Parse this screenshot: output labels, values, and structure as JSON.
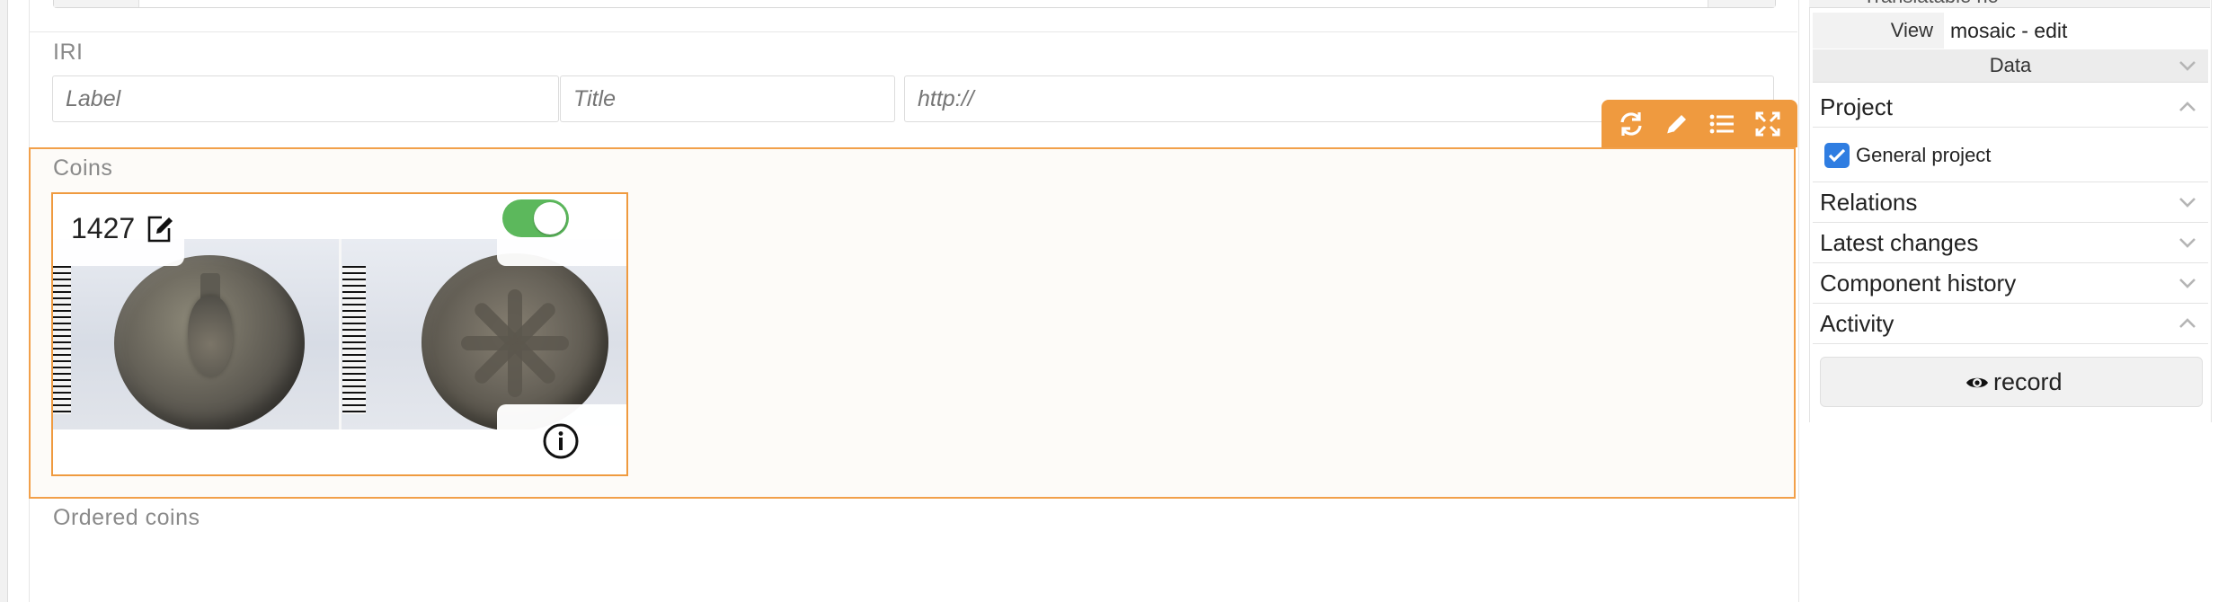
{
  "main": {
    "iri": {
      "label": "IRI",
      "label_placeholder": "Label",
      "title_placeholder": "Title",
      "url_placeholder": "http://"
    },
    "coins": {
      "label": "Coins",
      "card": {
        "record_id": "1427",
        "published": true,
        "image_alt": "Coin obverse and reverse"
      }
    },
    "ordered_coins": {
      "label": "Ordered coins"
    },
    "toolbar": {
      "icons": [
        "refresh-icon",
        "pencil-icon",
        "list-icon",
        "expand-icon"
      ]
    }
  },
  "sidebar": {
    "top_cut_text": "Translatable  no",
    "view_key": "View",
    "view_value": "mosaic - edit",
    "data_bar": "Data",
    "sections": {
      "project": "Project",
      "relations": "Relations",
      "latest_changes": "Latest changes",
      "component_history": "Component history",
      "activity": "Activity"
    },
    "project_option": "General project",
    "project_checked": true,
    "record_button": "record"
  },
  "colors": {
    "accent_orange": "#ef9a3f",
    "toggle_green": "#5cb85c",
    "checkbox_blue": "#2f7de1"
  }
}
